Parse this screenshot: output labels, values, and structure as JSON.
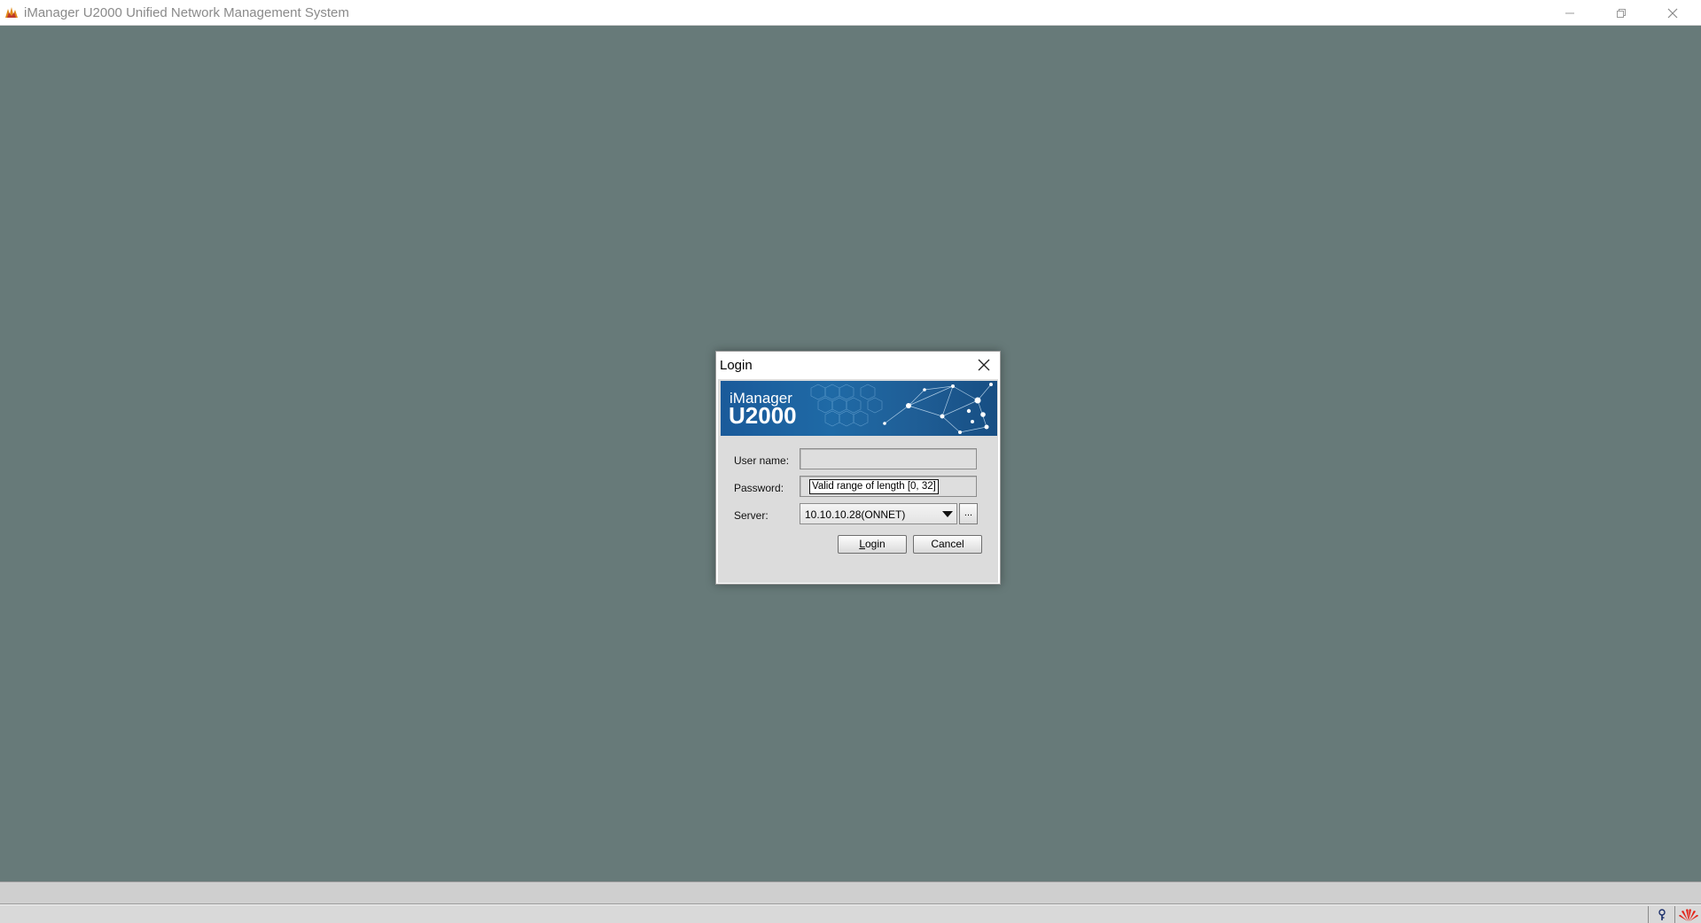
{
  "window": {
    "title": "iManager U2000 Unified Network Management System",
    "colors": {
      "desktop": "#677a79",
      "titlebar": "#ffffff",
      "brand_red": "#e3261b"
    }
  },
  "dialog": {
    "title": "Login",
    "banner": {
      "line1": "iManager",
      "line2": "U2000"
    },
    "fields": {
      "username_label": "User name:",
      "username_value": "",
      "password_label": "Password:",
      "password_value": "",
      "password_tooltip": "Valid range of length [0, 32]",
      "server_label": "Server:",
      "server_value": "10.10.10.28(ONNET)",
      "browse_label": "..."
    },
    "buttons": {
      "login_mnemonic": "L",
      "login_rest": "ogin",
      "cancel": "Cancel"
    }
  },
  "icons": {
    "app": "u2000-app-icon",
    "minimize": "minimize-icon",
    "maximize": "restore-icon",
    "close": "close-icon",
    "dialog_close": "close-icon",
    "status_1": "lock-status-icon",
    "status_2": "huawei-logo-icon"
  }
}
